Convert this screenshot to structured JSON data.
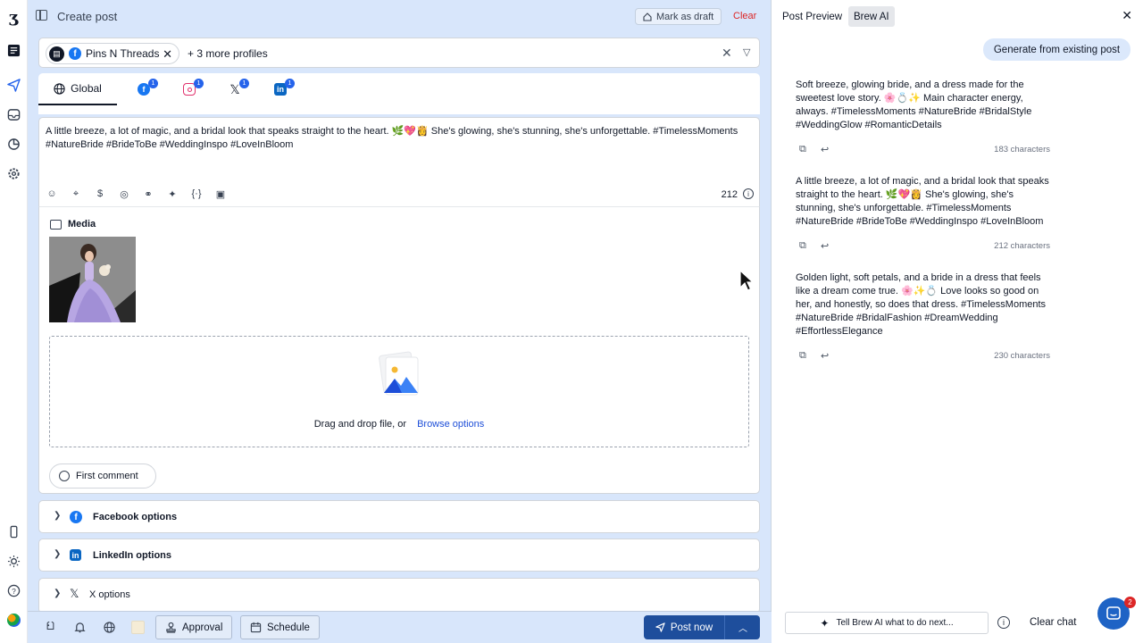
{
  "header": {
    "title": "Create post",
    "mark_draft": "Mark as draft",
    "clear": "Clear"
  },
  "profiles": {
    "selected_label": "Pins N Threads",
    "more": "+ 3 more profiles"
  },
  "tabs": {
    "global": "Global",
    "networks": [
      {
        "name": "facebook-icon",
        "badge": "1",
        "color": "#1877f2"
      },
      {
        "name": "instagram-icon",
        "badge": "1",
        "color": "#e1306c"
      },
      {
        "name": "x-icon",
        "badge": "1",
        "color": "#111827"
      },
      {
        "name": "linkedin-icon",
        "badge": "1",
        "color": "#0a66c2"
      }
    ]
  },
  "editor": {
    "text": "A little breeze, a lot of magic, and a bridal look that speaks straight to the heart. 🌿💖👸 She's glowing, she's stunning, she's unforgettable. #TimelessMoments #NatureBride #BrideToBe #WeddingInspo #LoveInBloom",
    "char_count": "212"
  },
  "media": {
    "heading": "Media",
    "drop_text": "Drag and drop file, or",
    "browse": "Browse options",
    "first_comment": "First comment"
  },
  "options": {
    "facebook": "Facebook options",
    "linkedin": "LinkedIn options",
    "x": "X options"
  },
  "footer": {
    "approval": "Approval",
    "schedule": "Schedule",
    "post_now": "Post now"
  },
  "side": {
    "tab_preview": "Post Preview",
    "tab_brew": "Brew AI",
    "generate_pill": "Generate from existing post",
    "suggestions": [
      {
        "text": "Soft breeze, glowing bride, and a dress made for the sweetest love story. 🌸💍✨ Main character energy, always. #TimelessMoments #NatureBride #BridalStyle #WeddingGlow #RomanticDetails",
        "count": "183 characters"
      },
      {
        "text": "A little breeze, a lot of magic, and a bridal look that speaks straight to the heart. 🌿💖👸 She's glowing, she's stunning, she's unforgettable. #TimelessMoments #NatureBride #BrideToBe #WeddingInspo #LoveInBloom",
        "count": "212 characters"
      },
      {
        "text": "Golden light, soft petals, and a bride in a dress that feels like a dream come true. 🌸✨💍 Love looks so good on her, and honestly, so does that dress. #TimelessMoments #NatureBride #BridalFashion #DreamWedding #EffortlessElegance",
        "count": "230 characters"
      }
    ],
    "ask_placeholder": "Tell Brew AI what to do next...",
    "clear_chat": "Clear chat",
    "chat_badge": "2"
  },
  "colors": {
    "accent": "#1e4e9c",
    "composer_bg": "#d8e6fb",
    "danger": "#dc2626"
  }
}
